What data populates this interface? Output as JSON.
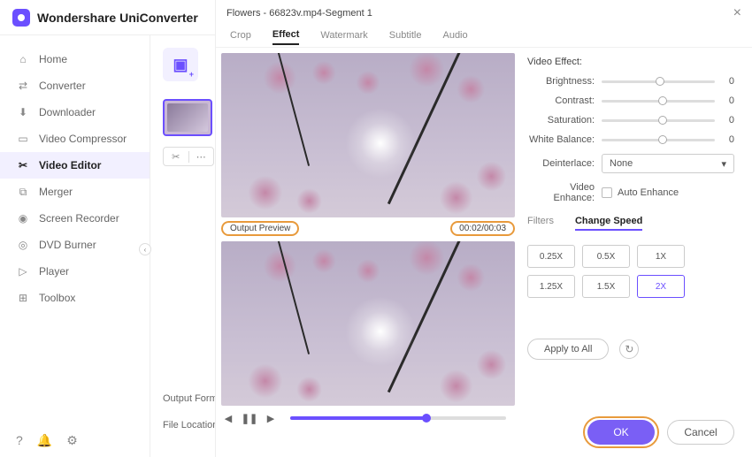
{
  "app": {
    "title": "Wondershare UniConverter"
  },
  "sidebar": {
    "items": [
      {
        "label": "Home"
      },
      {
        "label": "Converter"
      },
      {
        "label": "Downloader"
      },
      {
        "label": "Video Compressor"
      },
      {
        "label": "Video Editor"
      },
      {
        "label": "Merger"
      },
      {
        "label": "Screen Recorder"
      },
      {
        "label": "DVD Burner"
      },
      {
        "label": "Player"
      },
      {
        "label": "Toolbox"
      }
    ],
    "active_index": 4
  },
  "content": {
    "output_format_label": "Output Format:",
    "file_location_label": "File Location:"
  },
  "dialog": {
    "title": "Flowers - 66823v.mp4-Segment 1",
    "tabs": [
      "Crop",
      "Effect",
      "Watermark",
      "Subtitle",
      "Audio"
    ],
    "active_tab_index": 1,
    "preview_label": "Output Preview",
    "preview_time": "00:02/00:03",
    "effects": {
      "section_title": "Video Effect:",
      "sliders": [
        {
          "label": "Brightness:",
          "value": "0"
        },
        {
          "label": "Contrast:",
          "value": "0"
        },
        {
          "label": "Saturation:",
          "value": "0"
        },
        {
          "label": "White Balance:",
          "value": "0"
        }
      ],
      "deinterlace_label": "Deinterlace:",
      "deinterlace_value": "None",
      "enhance_label": "Video Enhance:",
      "enhance_option": "Auto Enhance"
    },
    "sub_tabs": [
      "Filters",
      "Change Speed"
    ],
    "active_sub_tab_index": 1,
    "speeds": [
      "0.25X",
      "0.5X",
      "1X",
      "1.25X",
      "1.5X",
      "2X"
    ],
    "selected_speed_index": 5,
    "apply_all_label": "Apply to All",
    "ok_label": "OK",
    "cancel_label": "Cancel"
  }
}
